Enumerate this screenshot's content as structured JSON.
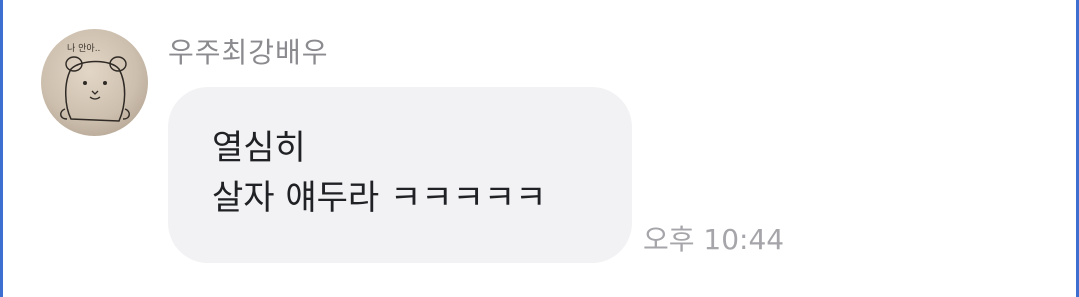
{
  "chat": {
    "message": {
      "sender_name": "우주최강배우",
      "avatar": {
        "icon": "hamster-drawing-avatar",
        "caption_text": "나 안아.."
      },
      "lines": [
        "열심히",
        "살자 얘두라 ㅋㅋㅋㅋㅋ"
      ],
      "time": "오후 10:44"
    }
  },
  "colors": {
    "bubble_background": "#f2f2f4",
    "sender_text": "#8b8b8f",
    "timestamp_text": "#a5a5aa",
    "message_text": "#202124",
    "window_edge": "#3d6fd1"
  }
}
